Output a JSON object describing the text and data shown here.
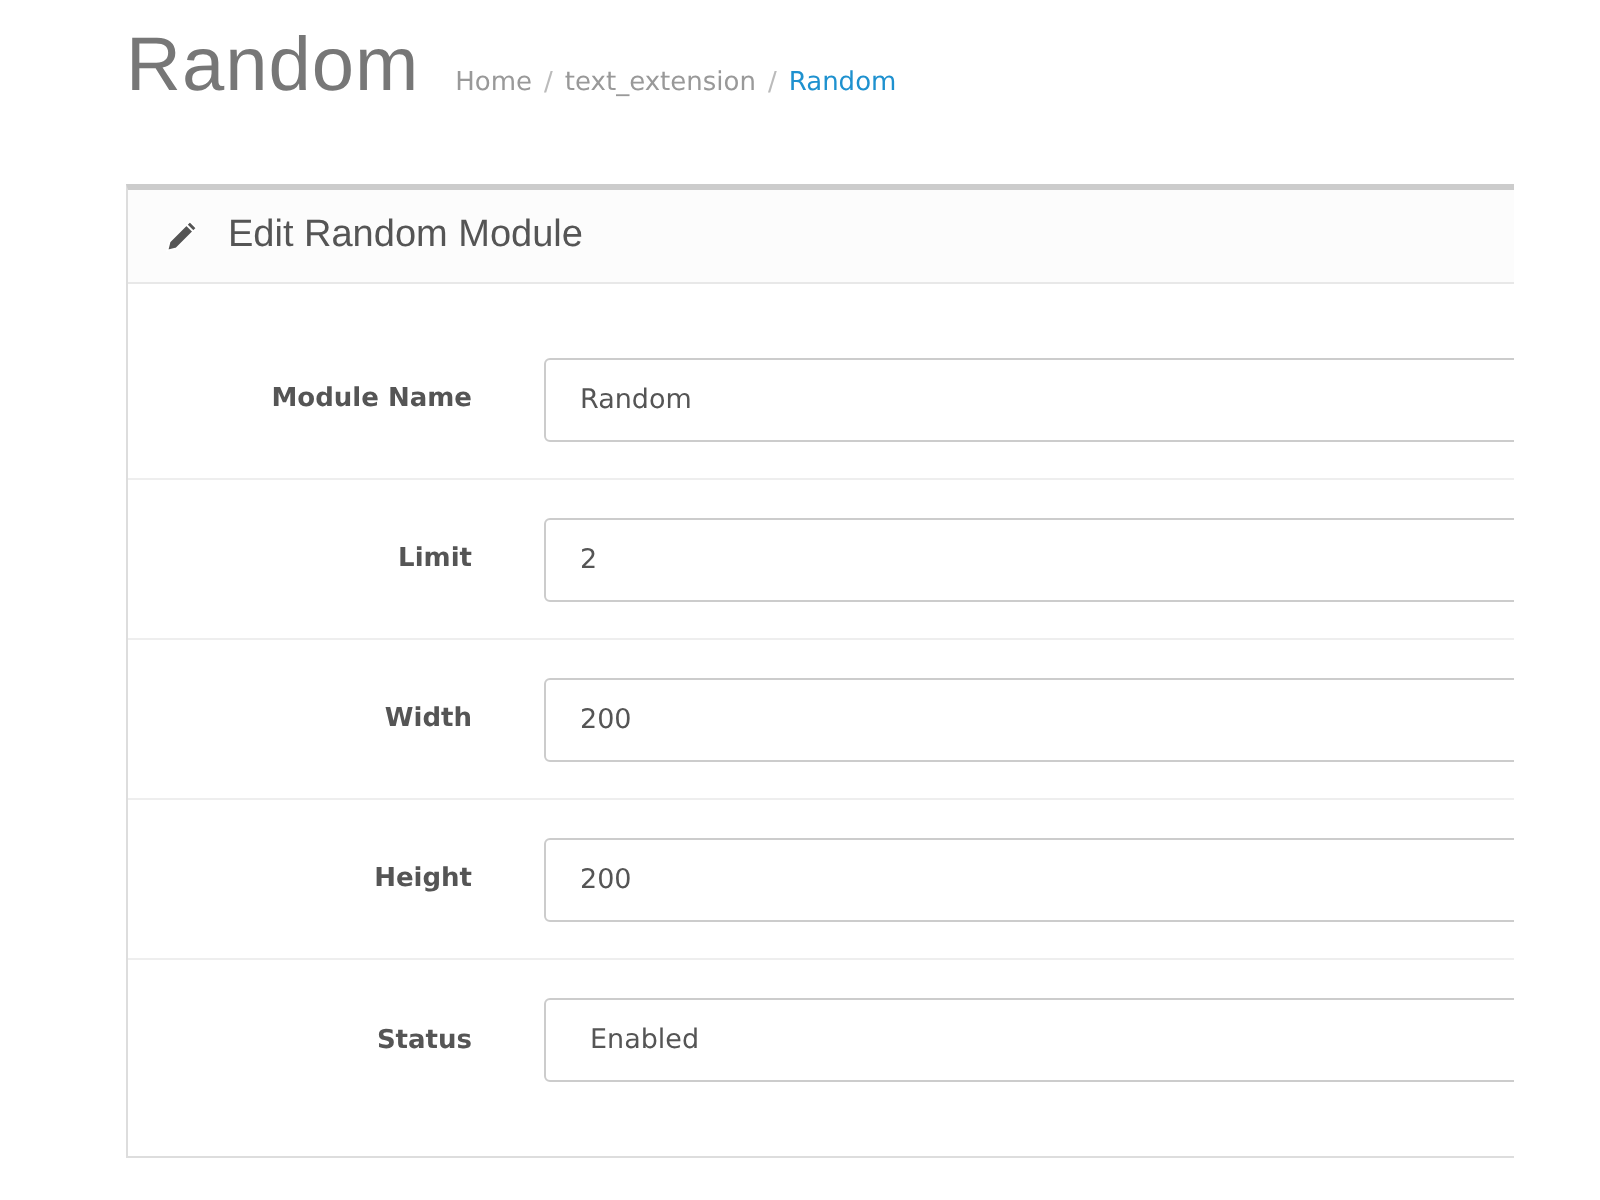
{
  "page_title": "Random",
  "breadcrumb": [
    {
      "label": "Home",
      "current": false
    },
    {
      "separator": "/",
      "label": "text_extension",
      "current": false
    },
    {
      "separator": "/",
      "label": "Random",
      "current": true
    }
  ],
  "panel": {
    "title": "Edit Random Module",
    "fields": [
      {
        "label": "Module Name",
        "kind": "text",
        "value": "Random"
      },
      {
        "label": "Limit",
        "kind": "text",
        "value": "2"
      },
      {
        "label": "Width",
        "kind": "text",
        "value": "200"
      },
      {
        "label": "Height",
        "kind": "text",
        "value": "200"
      },
      {
        "label": "Status",
        "kind": "select",
        "value": "Enabled"
      }
    ]
  }
}
